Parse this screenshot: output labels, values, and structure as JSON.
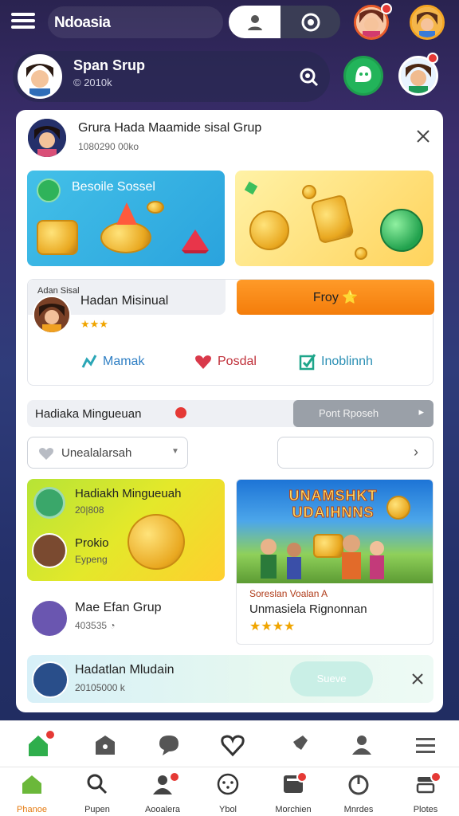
{
  "app": {
    "name": "Ndoasia"
  },
  "profile": {
    "name": "Span Srup",
    "sub": "© 2010k"
  },
  "card": {
    "title": "Grura Hada Maamide sisal Grup",
    "subtitle": "1080290 00ko",
    "tile1_label": "Besoile Sossel",
    "panel": {
      "caption": "Adan Sisal",
      "name": "Hadan Misinual",
      "stars": "★★★",
      "button": "Froy ⭐",
      "links": [
        "Mamak",
        "Posdal",
        "Inoblinnh"
      ]
    },
    "row": {
      "label": "Hadiaka Mingueuan",
      "button": "Pont Rposeh"
    },
    "select": {
      "value": "Unealalarsah"
    },
    "promo": {
      "title": "Hadiakh Mingueuah",
      "sub": "20|808",
      "title2": "Prokio",
      "sub2": "Eypeng"
    },
    "banner": {
      "headline": "UNAMSHKT UDAIHNNS",
      "line1": "Soreslan Voalan A",
      "line2": "Unmasiela Rignonnan",
      "stars": "★★★★"
    },
    "group": {
      "title": "Mae Efan Grup",
      "sub": "403535 ◔"
    },
    "notice": {
      "title": "Hadatlan Mludain",
      "sub": "20105000 k",
      "button": "Sueve"
    }
  },
  "nav": {
    "items": [
      "Phanoe",
      "Pupen",
      "Aooalera",
      "Ybol",
      "Morchien",
      "Mnrdes",
      "Plotes"
    ],
    "active_index": 0
  },
  "colors": {
    "accent": "#f47d0b",
    "green": "#22b45a",
    "badge": "#e53935"
  }
}
